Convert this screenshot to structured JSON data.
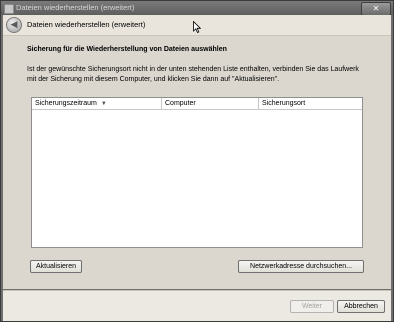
{
  "window": {
    "title": "Dateien wiederherstellen (erweitert)",
    "close_label": "✕"
  },
  "nav": {
    "back_glyph": "◀",
    "title": "Dateien wiederherstellen (erweitert)"
  },
  "content": {
    "heading": "Sicherung für die Wiederherstellung von Dateien auswählen",
    "description": "Ist der gewünschte Sicherungsort nicht in der unten stehenden Liste enthalten, verbinden Sie das Laufwerk mit der Sicherung mit diesem Computer, und klicken Sie dann auf \"Aktualisieren\".",
    "columns": [
      "Sicherungszeitraum",
      "Computer",
      "Sicherungsort"
    ],
    "sort_glyph": "▼",
    "rows": []
  },
  "buttons": {
    "refresh": "Aktualisieren",
    "browse": "Netzwerkadresse durchsuchen...",
    "next": "Weiter",
    "cancel": "Abbrechen"
  },
  "icons": {
    "app": "restore-app-icon",
    "back": "back-arrow-icon",
    "cursor": "mouse-pointer-icon",
    "sort": "sort-descending-icon"
  }
}
